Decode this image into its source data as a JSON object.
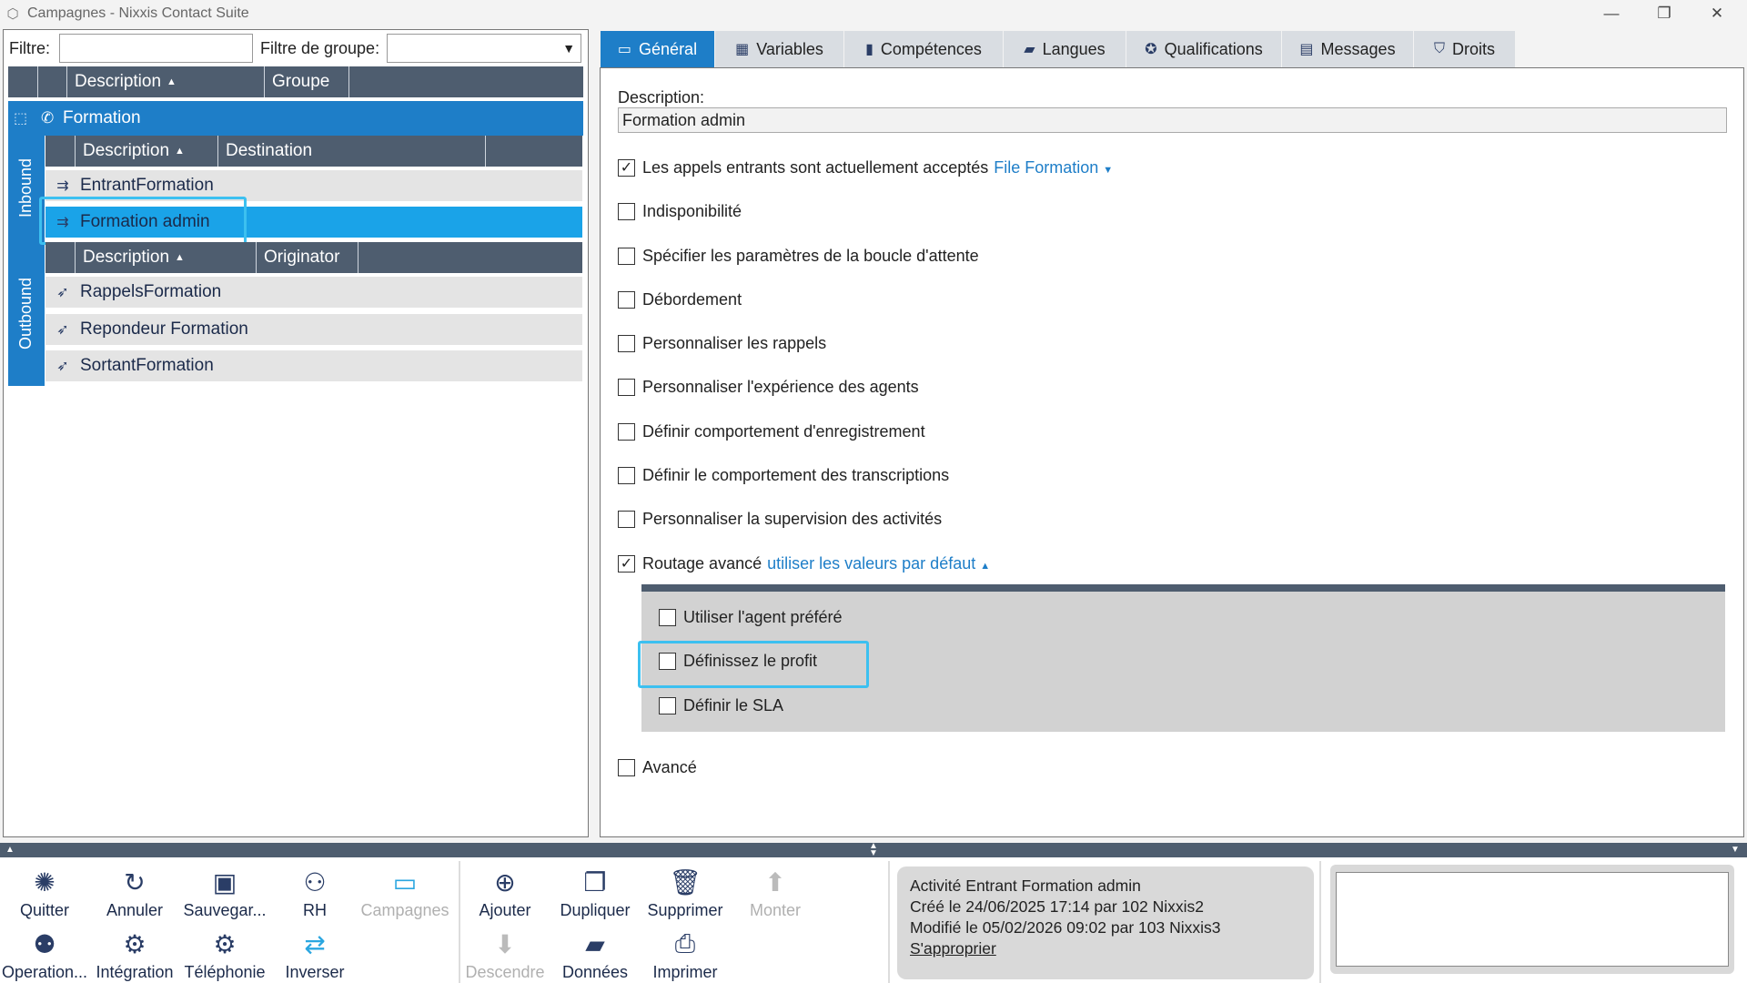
{
  "window": {
    "title": "Campagnes - Nixxis Contact Suite"
  },
  "left": {
    "filter_label": "Filtre:",
    "filter_value": "",
    "group_filter_label": "Filtre de groupe:",
    "group_filter_value": "",
    "main_headers": [
      "Description",
      "Groupe"
    ],
    "group_name": "Formation",
    "inbound_label": "Inbound",
    "inbound_headers": [
      "Description",
      "Destination"
    ],
    "inbound_rows": [
      "EntrantFormation",
      "Formation admin"
    ],
    "outbound_label": "Outbound",
    "outbound_headers": [
      "Description",
      "Originator"
    ],
    "outbound_rows": [
      "RappelsFormation",
      "Repondeur Formation",
      "SortantFormation"
    ]
  },
  "tabs": [
    {
      "label": "Général",
      "icon": "monitor-icon",
      "active": true
    },
    {
      "label": "Variables",
      "icon": "grid-icon"
    },
    {
      "label": "Compétences",
      "icon": "book-icon"
    },
    {
      "label": "Langues",
      "icon": "speech-icon"
    },
    {
      "label": "Qualifications",
      "icon": "badge-icon"
    },
    {
      "label": "Messages",
      "icon": "messages-icon"
    },
    {
      "label": "Droits",
      "icon": "shield-icon"
    }
  ],
  "general": {
    "description_label": "Description:",
    "description_value": "Formation admin",
    "options": [
      {
        "label": "Les appels entrants sont actuellement acceptés",
        "checked": true,
        "link": "File Formation"
      },
      {
        "label": "Indisponibilité",
        "checked": false
      },
      {
        "label": "Spécifier les paramètres de la boucle d'attente",
        "checked": false
      },
      {
        "label": "Débordement",
        "checked": false
      },
      {
        "label": "Personnaliser les rappels",
        "checked": false
      },
      {
        "label": "Personnaliser l'expérience des agents",
        "checked": false
      },
      {
        "label": "Définir comportement d'enregistrement",
        "checked": false
      },
      {
        "label": "Définir le comportement des transcriptions",
        "checked": false
      },
      {
        "label": "Personnaliser la supervision des activités",
        "checked": false
      },
      {
        "label": "Routage avancé",
        "checked": true,
        "link": "utiliser les valeurs par défaut"
      }
    ],
    "routing_sub": [
      {
        "label": "Utiliser l'agent préféré",
        "checked": false
      },
      {
        "label": "Définissez le profit",
        "checked": false
      },
      {
        "label": "Définir le SLA",
        "checked": false
      }
    ],
    "advanced": {
      "label": "Avancé",
      "checked": false
    }
  },
  "toolbar": {
    "row1": [
      "Quitter",
      "Annuler",
      "Sauvegar...",
      "RH",
      "Campagnes"
    ],
    "row2": [
      "Operation...",
      "Intégration",
      "Téléphonie",
      "Inverser"
    ],
    "row1b": [
      "Ajouter",
      "Dupliquer",
      "Supprimer",
      "Monter"
    ],
    "row2b": [
      "Descendre",
      "Données",
      "Imprimer"
    ]
  },
  "info": {
    "line1": "Activité Entrant Formation admin",
    "line2": "Créé le 24/06/2025 17:14 par 102 Nixxis2",
    "line3": "Modifié le 05/02/2026 09:02 par 103 Nixxis3",
    "link": "S'approprier"
  }
}
